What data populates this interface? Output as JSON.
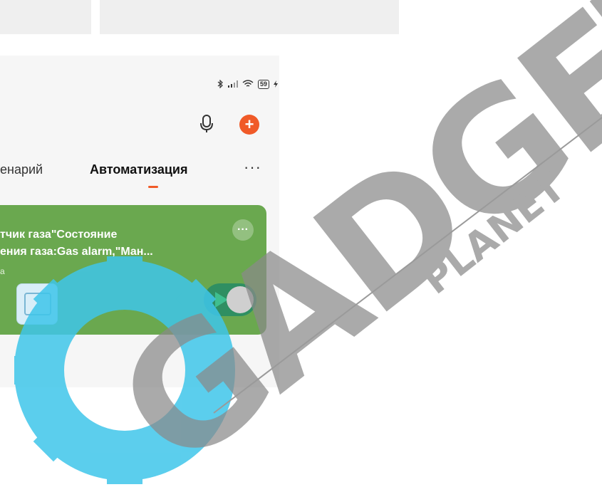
{
  "status_bar": {
    "bluetooth_icon": "bluetooth-icon",
    "signal_icon": "signal-icon",
    "wifi_icon": "wifi-icon",
    "battery_text": "59"
  },
  "header": {
    "mic_icon": "microphone-icon",
    "add_icon": "plus-icon",
    "add_color": "#f05a28"
  },
  "tabs": {
    "scene_label": "енарий",
    "automation_label": "Автоматизация",
    "more_label": "···",
    "active_color": "#f05a28"
  },
  "card": {
    "title_line1": "тчик газа\"Состояние",
    "title_line2": "ения газа:Gas alarm,\"Ман...",
    "subtitle": "а",
    "more_label": "···",
    "arrow_label": "›",
    "background": "#6aa84f"
  },
  "watermark": {
    "brand": "GADGET",
    "subbrand": "PLANET"
  }
}
